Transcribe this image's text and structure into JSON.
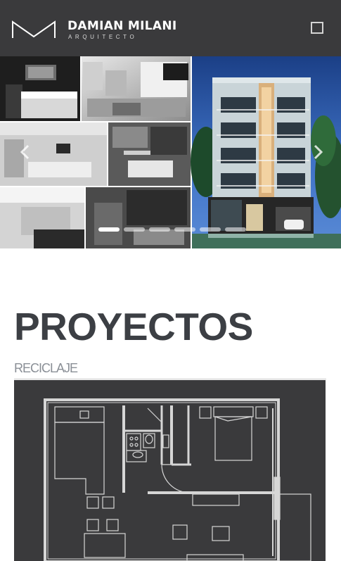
{
  "header": {
    "brand_name": "DAMIAN MILANI",
    "brand_subtitle": "ARQUITECTO",
    "menu_icon": "menu-square-icon",
    "background": "#3a3a3c"
  },
  "slider": {
    "slides": [
      "interior-renders-collage",
      "building-facade-render"
    ],
    "prev_icon": "chevron-left-icon",
    "next_icon": "chevron-right-icon",
    "pager_count": 6
  },
  "section": {
    "title": "PROYECTOS"
  },
  "project": {
    "category": "RECICLAJE",
    "image": "floor-plan-drawing"
  }
}
